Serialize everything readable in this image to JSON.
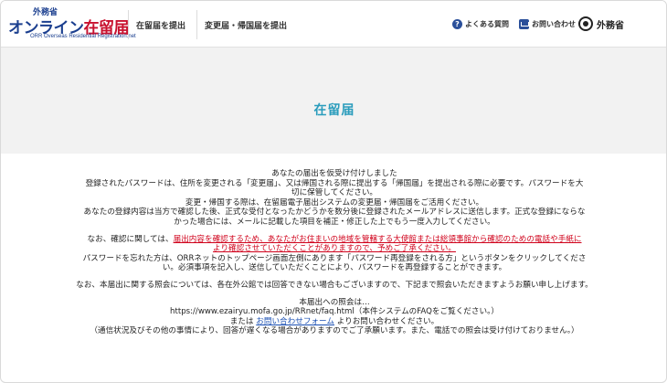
{
  "header": {
    "logo": {
      "top": "外務省",
      "main_prefix": "オンライン",
      "main_suffix": "在留届",
      "sub": "ORR Overseas Residential Registration.net"
    },
    "nav": [
      {
        "label": "在留届を提出"
      },
      {
        "label": "変更届・帰国届を提出"
      }
    ],
    "faq_label": "よくある質問",
    "contact_label": "お問い合わせ",
    "ministry_label": "外務省"
  },
  "title": "在留届",
  "body": {
    "p1": [
      "あなたの届出を仮受け付けしました",
      "登録されたパスワードは、住所を変更される「変更届」、又は帰国される際に提出する「帰国届」を提出される際に必要です。パスワードを大",
      "切に保管してください。",
      "変更・帰国する際は、在留届電子届出システムの変更届・帰国届をご活用ください。",
      "あなたの登録内容は当方で確認した後、正式な受付となったかどうかを数分後に登録されたメールアドレスに送信します。正式な登録にならな",
      "かった場合には、メールに記載した項目を補正・修正した上でもう一度入力してください。"
    ],
    "p2_prefix": "なお、確認に関しては、",
    "p2_red_line1": "届出内容を確認するため、あなたがお住まいの地域を管轄する大使館または総領事館から確認のための電話や手紙に",
    "p2_red_line2": "より確認させていただくことがありますので、予めご了承ください。",
    "p3": [
      "パスワードを忘れた方は、ORRネットのトップページ画面左側にあります「パスワード再登録をされる方」というボタンをクリックしてくださ",
      "い。必須事項を記入し、送信していただくことにより、パスワードを再登録することができます。"
    ],
    "p4": "なお、本届出に関する照会については、各在外公館では回答できない場合もございますので、下記まで照会いただきますようお願い申し上げます。",
    "p5_title": "本届出への照会は…",
    "p5_faq": "https://www.ezairyu.mofa.go.jp/RRnet/faq.html（本件システムのFAQをご覧ください。）",
    "p5_or": "または",
    "p5_link": "お問い合わせフォーム",
    "p5_after": "よりお問い合わせください。",
    "p5_note": "（通信状況及びその他の事情により、回答が遅くなる場合がありますのでご了承願います。また、電話での照会は受け付けておりません。）"
  }
}
